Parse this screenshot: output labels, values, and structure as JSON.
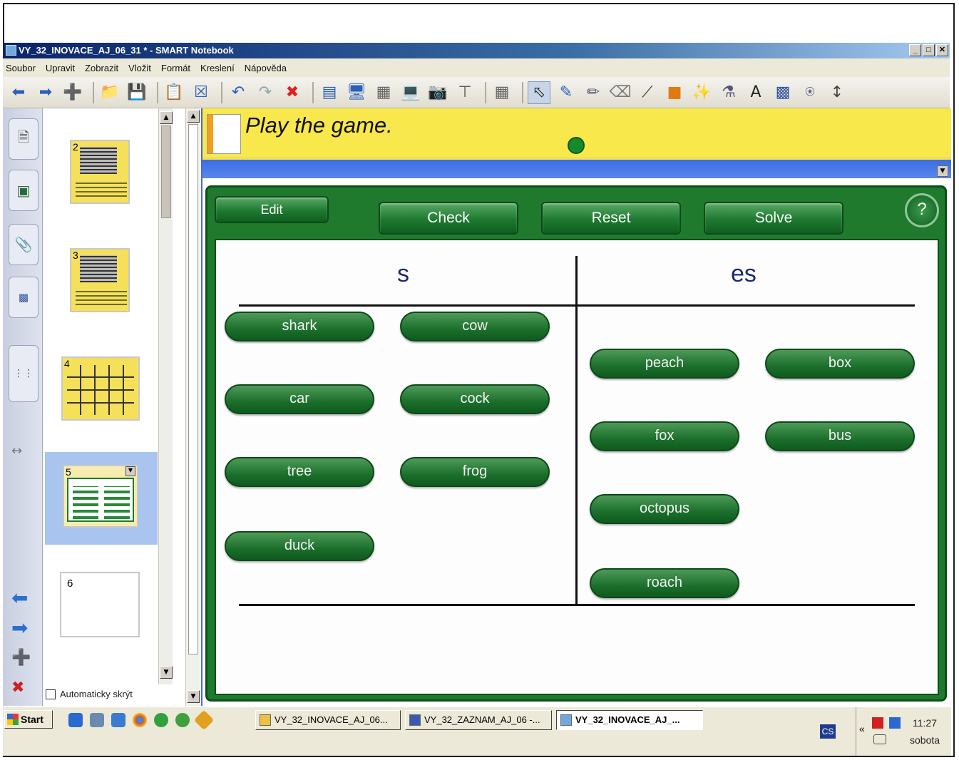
{
  "window": {
    "title": "VY_32_INOVACE_AJ_06_31 * - SMART Notebook",
    "buttons": [
      "_",
      "ี",
      "X"
    ]
  },
  "menu": [
    "Soubor",
    "Upravit",
    "Zobrazit",
    "Vložit",
    "Formát",
    "Kreslení",
    "Nápověda"
  ],
  "toolbar": {
    "icons": [
      "back-icon",
      "forward-icon",
      "add-page-icon",
      "open-icon",
      "save-icon",
      "paste-icon",
      "delete-page-icon",
      "undo-icon",
      "redo-icon",
      "delete-icon",
      "screen-shade-icon",
      "full-screen-icon",
      "transparent-background-icon",
      "display-icon",
      "capture-icon",
      "document-camera-icon",
      "table-icon",
      "select-icon",
      "pen-icon",
      "creative-pen-icon",
      "eraser-icon",
      "line-icon",
      "shapes-icon",
      "magic-pen-icon",
      "fill-icon",
      "text-icon",
      "properties-icon",
      "measure-icon",
      "more-icon"
    ]
  },
  "sorter": {
    "pages": [
      "2",
      "3",
      "4",
      "5",
      "6"
    ],
    "selected_page": "5",
    "autohide_label": "Automaticky skrýt"
  },
  "slide": {
    "title": "Play the game.",
    "buttons": {
      "edit": "Edit",
      "check": "Check",
      "reset": "Reset",
      "solve": "Solve",
      "help": "?"
    },
    "columns": {
      "left_heading": "s",
      "right_heading": "es"
    },
    "left_words": [
      "shark",
      "cow",
      "car",
      "cock",
      "tree",
      "frog",
      "duck"
    ],
    "right_words": [
      "peach",
      "box",
      "fox",
      "bus",
      "octopus",
      "roach"
    ]
  },
  "taskbar": {
    "start": "Start",
    "tasks": [
      "VY_32_INOVACE_AJ_06...",
      "VY_32_ZAZNAM_AJ_06 -...",
      "VY_32_INOVACE_AJ_..."
    ],
    "language": "CS",
    "time": "11:27",
    "day": "sobota"
  }
}
